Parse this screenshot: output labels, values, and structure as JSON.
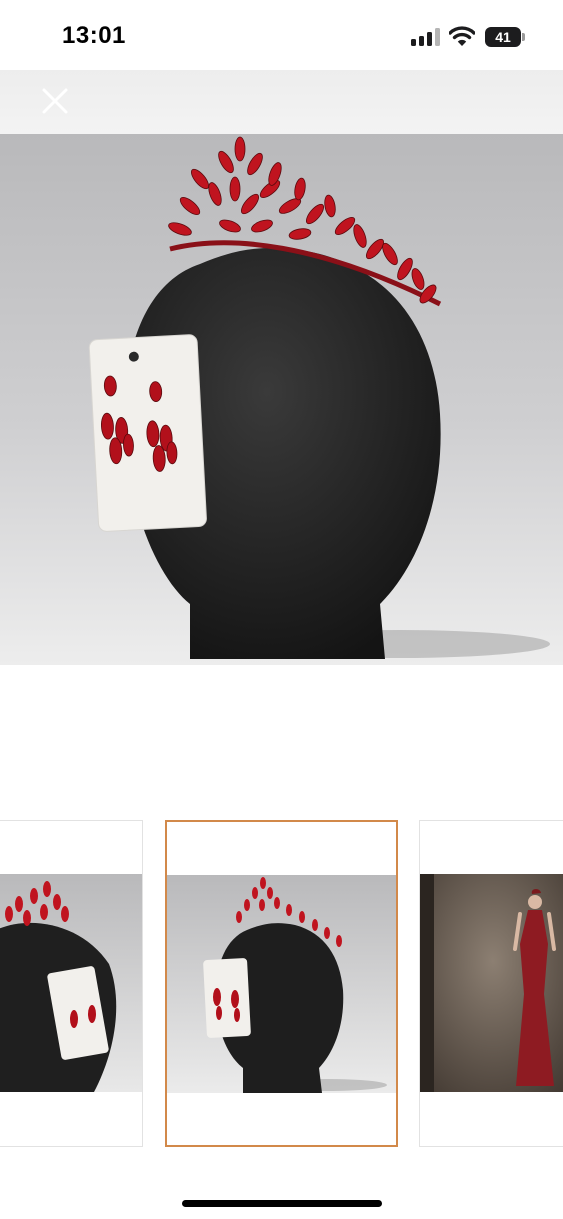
{
  "status_bar": {
    "time": "13:01",
    "battery_level": "41",
    "icons": [
      "cellular-signal-icon",
      "wifi-icon",
      "battery-icon"
    ]
  },
  "header": {
    "close_icon": "close-icon"
  },
  "gallery": {
    "main_image": "red-crystal-tiara-and-earrings-on-black-mannequin-head",
    "selected_index": 1,
    "thumbnails": [
      {
        "image": "tiara-and-earrings-on-mannequin-side-view"
      },
      {
        "image": "tiara-and-earrings-on-mannequin"
      },
      {
        "image": "model-in-red-satin-gown-wearing-tiara"
      }
    ],
    "selected_border_color": "#d2894a"
  }
}
